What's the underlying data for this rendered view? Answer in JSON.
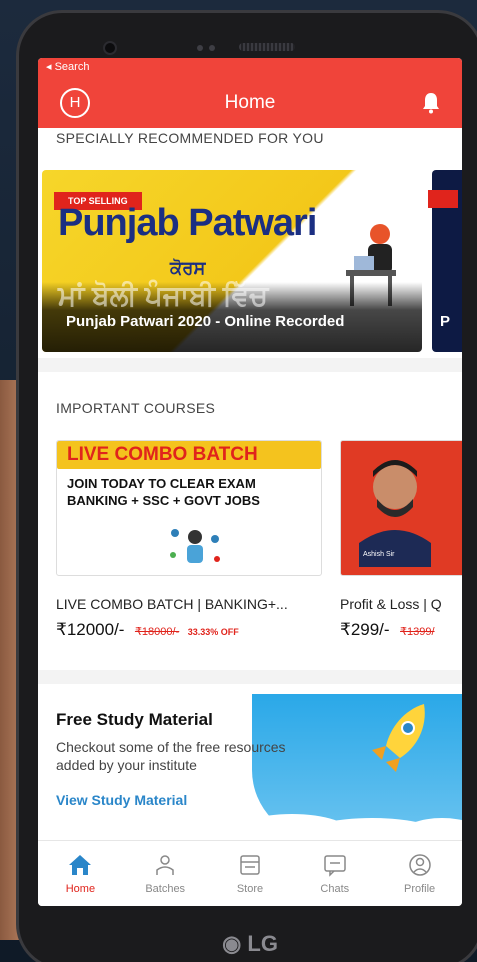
{
  "status_bar": {
    "back_label": "◂ Search"
  },
  "header": {
    "avatar_letter": "H",
    "title": "Home"
  },
  "recommended": {
    "label": "SPECIALLY RECOMMENDED FOR YOU",
    "banners": [
      {
        "badge": "TOP SELLING",
        "big_text": "Punjab Patwari",
        "sub_text": "ਕੋਰਸ",
        "punjabi_text": "ਮਾਂ ਬੋਲੀ ਪੰਜਾਬੀ ਵਿੱਚ",
        "caption": "Punjab Patwari 2020 - Online Recorded"
      },
      {
        "caption": "P"
      }
    ]
  },
  "important": {
    "label": "IMPORTANT COURSES",
    "courses": [
      {
        "banner_title": "LIVE COMBO BATCH",
        "banner_join": "JOIN TODAY TO CLEAR EXAM",
        "banner_exams": "BANKING + SSC + GOVT JOBS",
        "name": "LIVE COMBO BATCH | BANKING+...",
        "price": "₹12000/-",
        "old_price": "₹18000/-",
        "discount": "33.33% OFF"
      },
      {
        "teacher_name": "Ashish Sir",
        "name": "Profit & Loss | Q",
        "price": "₹299/-",
        "old_price": "₹1399/"
      }
    ]
  },
  "study": {
    "title": "Free Study Material",
    "description": "Checkout some of the free resources added by your institute",
    "link": "View Study Material"
  },
  "tabs": [
    {
      "label": "Home",
      "icon": "home-icon"
    },
    {
      "label": "Batches",
      "icon": "batches-icon"
    },
    {
      "label": "Store",
      "icon": "store-icon"
    },
    {
      "label": "Chats",
      "icon": "chats-icon"
    },
    {
      "label": "Profile",
      "icon": "profile-icon"
    }
  ],
  "device": {
    "brand": "LG"
  },
  "colors": {
    "accent": "#f0443a",
    "link": "#2a86c9",
    "active_tab": "#e0241c"
  }
}
